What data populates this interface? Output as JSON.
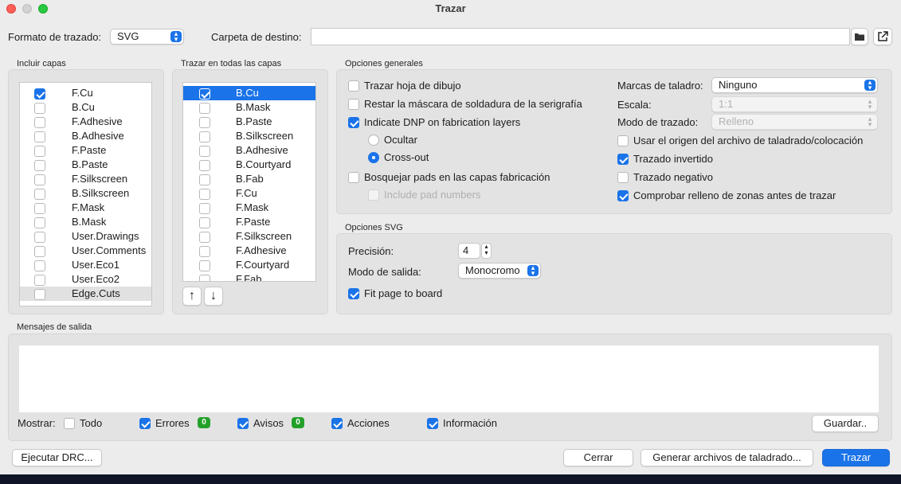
{
  "window": {
    "title": "Trazar"
  },
  "top": {
    "format_label": "Formato de trazado:",
    "format_value": "SVG",
    "dest_label": "Carpeta de destino:",
    "dest_value": ""
  },
  "include_layers": {
    "title": "Incluir capas",
    "items": [
      {
        "label": "F.Cu",
        "checked": true
      },
      {
        "label": "B.Cu",
        "checked": false
      },
      {
        "label": "F.Adhesive",
        "checked": false
      },
      {
        "label": "B.Adhesive",
        "checked": false
      },
      {
        "label": "F.Paste",
        "checked": false
      },
      {
        "label": "B.Paste",
        "checked": false
      },
      {
        "label": "F.Silkscreen",
        "checked": false
      },
      {
        "label": "B.Silkscreen",
        "checked": false
      },
      {
        "label": "F.Mask",
        "checked": false
      },
      {
        "label": "B.Mask",
        "checked": false
      },
      {
        "label": "User.Drawings",
        "checked": false
      },
      {
        "label": "User.Comments",
        "checked": false
      },
      {
        "label": "User.Eco1",
        "checked": false
      },
      {
        "label": "User.Eco2",
        "checked": false
      },
      {
        "label": "Edge.Cuts",
        "checked": false
      }
    ]
  },
  "all_layers": {
    "title": "Trazar en todas las capas",
    "items": [
      {
        "label": "B.Cu",
        "checked": true
      },
      {
        "label": "B.Mask",
        "checked": false
      },
      {
        "label": "B.Paste",
        "checked": false
      },
      {
        "label": "B.Silkscreen",
        "checked": false
      },
      {
        "label": "B.Adhesive",
        "checked": false
      },
      {
        "label": "B.Courtyard",
        "checked": false
      },
      {
        "label": "B.Fab",
        "checked": false
      },
      {
        "label": "F.Cu",
        "checked": false
      },
      {
        "label": "F.Mask",
        "checked": false
      },
      {
        "label": "F.Paste",
        "checked": false
      },
      {
        "label": "F.Silkscreen",
        "checked": false
      },
      {
        "label": "F.Adhesive",
        "checked": false
      },
      {
        "label": "F.Courtyard",
        "checked": false
      },
      {
        "label": "F.Fab",
        "checked": false
      }
    ]
  },
  "general": {
    "title": "Opciones generales",
    "plot_sheet": "Trazar hoja de dibujo",
    "subtract_mask": "Restar la máscara de soldadura de la serigrafía",
    "indicate_dnp": "Indicate DNP on fabrication layers",
    "hide": "Ocultar",
    "cross_out": "Cross-out",
    "sketch_pads": "Bosquejar pads en las capas fabricación",
    "include_pad_numbers": "Include pad numbers",
    "drill_marks_label": "Marcas de taladro:",
    "drill_marks_value": "Ninguno",
    "scale_label": "Escala:",
    "scale_value": "1:1",
    "plot_mode_label": "Modo de trazado:",
    "plot_mode_value": "Relleno",
    "use_drill_origin": "Usar el origen del archivo de taladrado/colocación",
    "mirrored": "Trazado invertido",
    "negative": "Trazado negativo",
    "check_zones": "Comprobar relleno de zonas antes de trazar"
  },
  "svg": {
    "title": "Opciones SVG",
    "precision_label": "Precisión:",
    "precision_value": "4",
    "output_mode_label": "Modo de salida:",
    "output_mode_value": "Monocromo",
    "fit_page": "Fit page to board"
  },
  "messages": {
    "title": "Mensajes de salida",
    "show_label": "Mostrar:",
    "all": "Todo",
    "errors": "Errores",
    "errors_count": "0",
    "warnings": "Avisos",
    "warnings_count": "0",
    "actions": "Acciones",
    "info": "Información",
    "save": "Guardar.."
  },
  "footer": {
    "run_drc": "Ejecutar DRC...",
    "close": "Cerrar",
    "gen_drill": "Generar archivos de taladrado...",
    "plot": "Trazar"
  },
  "colors": {
    "accent": "#1a73e8",
    "badge": "#23a02a"
  }
}
